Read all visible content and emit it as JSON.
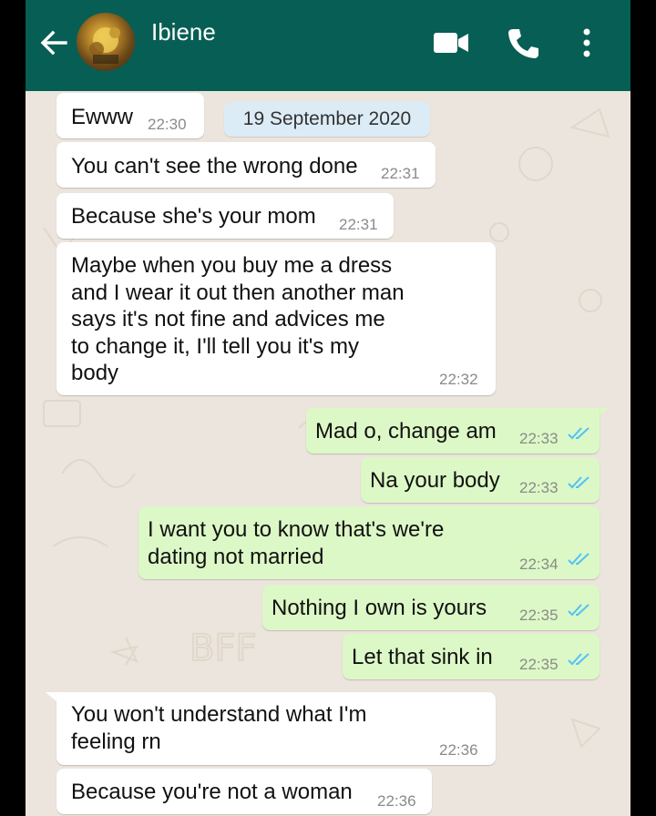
{
  "header": {
    "contact_name": "Ibiene",
    "colors": {
      "bar": "#075e54",
      "wallpaper": "#ece5dd",
      "incoming": "#ffffff",
      "outgoing": "#dcf8c6",
      "read_ticks": "#4fc3f7"
    },
    "icons": [
      "back-arrow-icon",
      "avatar",
      "video-call-icon",
      "voice-call-icon",
      "more-options-icon"
    ]
  },
  "date_chip": "19 September 2020",
  "messages": [
    {
      "dir": "in",
      "text": "Ewww",
      "time": "22:30"
    },
    {
      "dir": "in",
      "text": "You can't see the wrong done",
      "time": "22:31"
    },
    {
      "dir": "in",
      "text": "Because she's your mom",
      "time": "22:31"
    },
    {
      "dir": "in",
      "text": "Maybe when you buy me a dress\nand I wear it out then another man\nsays it's not fine and advices me\nto change it, I'll tell you it's my\nbody",
      "time": "22:32"
    },
    {
      "dir": "out",
      "text": "Mad o, change am",
      "time": "22:33",
      "status": "read"
    },
    {
      "dir": "out",
      "text": "Na your body",
      "time": "22:33",
      "status": "read"
    },
    {
      "dir": "out",
      "text": "I want you to know that's we're\ndating not married",
      "time": "22:34",
      "status": "read"
    },
    {
      "dir": "out",
      "text": "Nothing I own is yours",
      "time": "22:35",
      "status": "read"
    },
    {
      "dir": "out",
      "text": "Let that sink in",
      "time": "22:35",
      "status": "read"
    },
    {
      "dir": "in",
      "text": "You won't understand what I'm\nfeeling rn",
      "time": "22:36"
    },
    {
      "dir": "in",
      "text": "Because you're not a woman",
      "time": "22:36"
    }
  ]
}
